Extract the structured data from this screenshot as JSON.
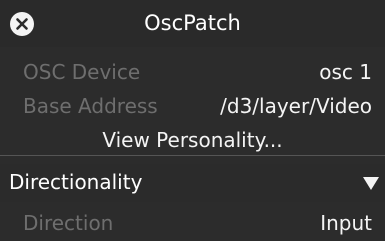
{
  "window": {
    "title": "OscPatch"
  },
  "fields": {
    "osc_device": {
      "label": "OSC Device",
      "value": "osc 1"
    },
    "base_address": {
      "label": "Base Address",
      "value": "/d3/layer/Video"
    }
  },
  "actions": {
    "view_personality": "View Personality..."
  },
  "directionality": {
    "section_title": "Directionality",
    "direction": {
      "label": "Direction",
      "value": "Input"
    }
  },
  "icons": {
    "close": "close-icon",
    "expand": "triangle-down-icon"
  }
}
